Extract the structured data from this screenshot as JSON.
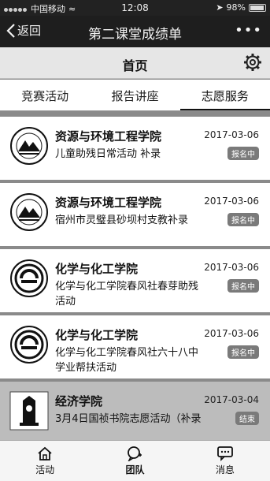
{
  "status": {
    "carrier": "中国移动",
    "time": "12:08",
    "battery": "98%"
  },
  "nav": {
    "back_label": "返回",
    "title": "第二课堂成绩单",
    "more_label": "•••"
  },
  "page": {
    "title": "首页"
  },
  "tabs": [
    {
      "label": "竞赛活动",
      "active": false
    },
    {
      "label": "报告讲座",
      "active": false
    },
    {
      "label": "志愿服务",
      "active": true
    }
  ],
  "items": [
    {
      "college": "资源与环境工程学院",
      "date": "2017-03-06",
      "activity": "儿童助残日常活动 补录",
      "status": "报名中",
      "logo": "seal-mountain-icon"
    },
    {
      "college": "资源与环境工程学院",
      "date": "2017-03-06",
      "activity": "宿州市灵璧县砂坝村支教补录",
      "status": "报名中",
      "logo": "seal-mountain-icon"
    },
    {
      "college": "化学与化工学院",
      "date": "2017-03-06",
      "activity": "化学与化工学院春风社春芽助残活动",
      "status": "报名中",
      "logo": "seal-chemistry-icon"
    },
    {
      "college": "化学与化工学院",
      "date": "2017-03-06",
      "activity": "化学与化工学院春风社六十八中学业帮扶活动",
      "status": "报名中",
      "logo": "seal-chemistry-icon"
    },
    {
      "college": "经济学院",
      "date": "2017-03-04",
      "activity": "3月4日国祯书院志愿活动（补录",
      "status": "结束",
      "logo": "economics-logo-icon"
    }
  ],
  "tabbar": [
    {
      "label": "活动",
      "icon": "home-icon",
      "active": false
    },
    {
      "label": "团队",
      "icon": "team-chat-icon",
      "active": true
    },
    {
      "label": "消息",
      "icon": "message-icon",
      "active": false
    }
  ]
}
